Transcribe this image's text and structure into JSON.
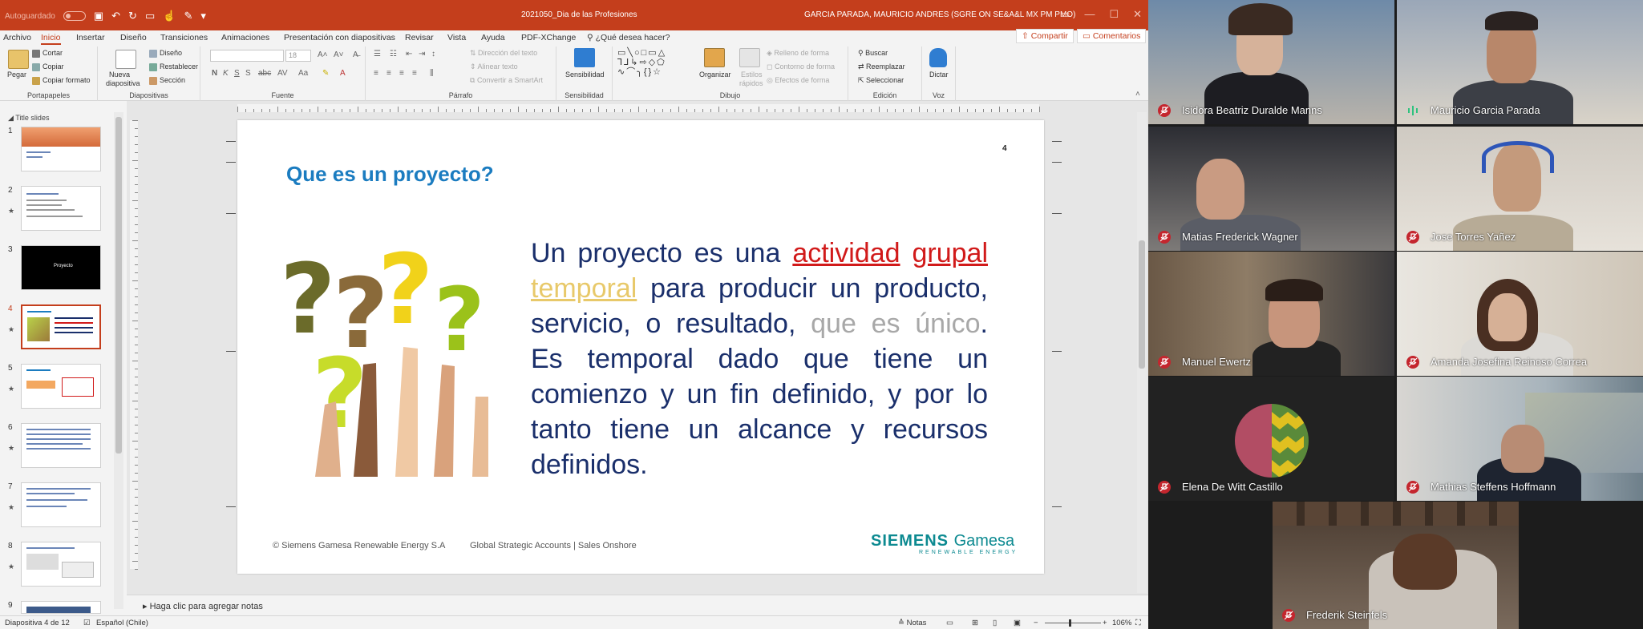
{
  "titlebar": {
    "autosave": "Autoguardado",
    "document": "2021050_Dia de las Profesiones",
    "user": "GARCIA PARADA, MAURICIO ANDRES (SGRE ON SE&A&L MX PM PMO)"
  },
  "tabs": [
    "Archivo",
    "Inicio",
    "Insertar",
    "Diseño",
    "Transiciones",
    "Animaciones",
    "Presentación con diapositivas",
    "Revisar",
    "Vista",
    "Ayuda",
    "PDF-XChange",
    "¿Qué desea hacer?"
  ],
  "share_label": "Compartir",
  "comments_label": "Comentarios",
  "ribbon": {
    "portapapeles": {
      "label": "Portapapeles",
      "paste": "Pegar",
      "cut": "Cortar",
      "copy": "Copiar",
      "format": "Copiar formato"
    },
    "diapositivas": {
      "label": "Diapositivas",
      "new": "Nueva",
      "new2": "diapositiva",
      "design": "Diseño",
      "reset": "Restablecer",
      "section": "Sección"
    },
    "fuente": {
      "label": "Fuente",
      "size": "18"
    },
    "parrafo": {
      "label": "Párrafo",
      "dir": "Dirección del texto",
      "align": "Alinear texto",
      "smartart": "Convertir a SmartArt"
    },
    "sensibilidad": {
      "label": "Sensibilidad",
      "btn": "Sensibilidad"
    },
    "dibujo": {
      "label": "Dibujo",
      "arrange": "Organizar",
      "quick": "Estilos",
      "quick2": "rápidos",
      "fill": "Relleno de forma",
      "outline": "Contorno de forma",
      "effects": "Efectos de forma"
    },
    "edicion": {
      "label": "Edición",
      "find": "Buscar",
      "replace": "Reemplazar",
      "select": "Seleccionar"
    },
    "voz": {
      "label": "Voz",
      "dictate": "Dictar"
    }
  },
  "thumbpane": {
    "header": "Title slides",
    "slides": [
      {
        "num": "1",
        "star": false
      },
      {
        "num": "2",
        "star": true
      },
      {
        "num": "3",
        "star": false,
        "text": "Proyecto"
      },
      {
        "num": "4",
        "star": true
      },
      {
        "num": "5",
        "star": true
      },
      {
        "num": "6",
        "star": true
      },
      {
        "num": "7",
        "star": true
      },
      {
        "num": "8",
        "star": true
      },
      {
        "num": "9",
        "star": true
      }
    ]
  },
  "slide": {
    "number": "4",
    "title": "Que es un proyecto?",
    "text": {
      "p1": "Un proyecto es una ",
      "red1": "actividad",
      "sp": " ",
      "red2": "grupal",
      "yellow": "temporal",
      "p2": " para producir un producto, servicio, o resultado, ",
      "gray": "que es único",
      "p3": ". Es temporal dado que tiene un comienzo y un fin definido, y por lo tanto tiene un alcance y recursos definidos."
    },
    "footer_left": "© Siemens Gamesa Renewable Energy S.A",
    "footer_right": "Global Strategic Accounts  | Sales Onshore",
    "brand_siemens": "SIEMENS",
    "brand_gamesa": "Gamesa",
    "brand_sub": "RENEWABLE ENERGY"
  },
  "notes_placeholder": "Haga clic para agregar notas",
  "statusbar": {
    "slide_info": "Diapositiva 4 de 12",
    "language": "Español (Chile)",
    "notes": "Notas",
    "zoom": "106%"
  },
  "participants": [
    {
      "name": "Isidora Beatriz Duralde Manns",
      "muted": true
    },
    {
      "name": "Mauricio Garcia Parada",
      "muted": false
    },
    {
      "name": "Matias Frederick Wagner",
      "muted": true
    },
    {
      "name": "Jose Torres Yañez",
      "muted": true
    },
    {
      "name": "Manuel Ewertz",
      "muted": true
    },
    {
      "name": "Amanda Josefina Reinoso Correa",
      "muted": true
    },
    {
      "name": "Elena De Witt Castillo",
      "muted": true
    },
    {
      "name": "Mathias Steffens Hoffmann",
      "muted": true
    },
    {
      "name": "Frederik Steinfels",
      "muted": true
    }
  ],
  "colors": {
    "ppt_accent": "#c43e1c",
    "title_blue": "#1b7cc0",
    "text_navy": "#1a2f6b",
    "muted_red": "#c4262e",
    "speaking_green": "#2ec27e"
  }
}
